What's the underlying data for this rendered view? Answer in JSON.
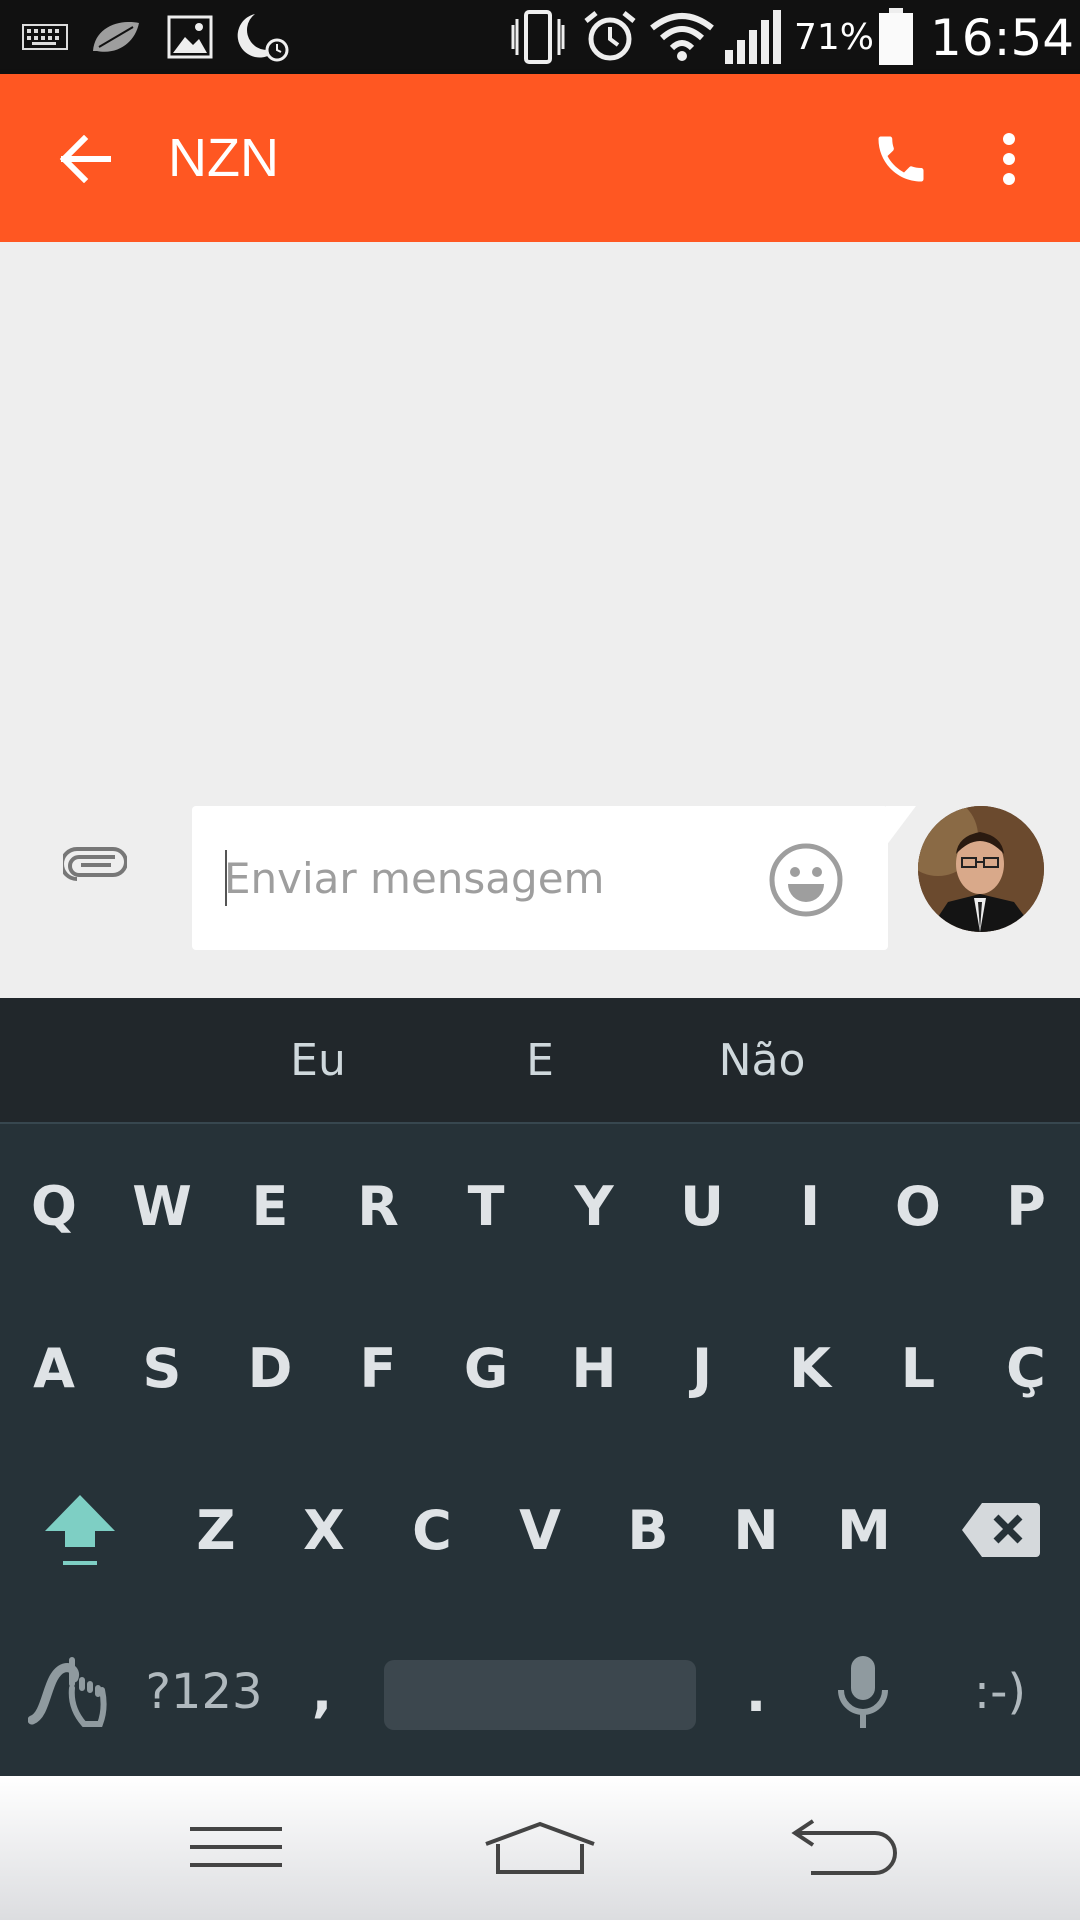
{
  "status_bar": {
    "battery_percent": "71%",
    "time": "16:54",
    "icons": [
      "keyboard-icon",
      "leaf-icon",
      "image-icon",
      "moon-clock-icon",
      "vibrate-icon",
      "alarm-icon",
      "wifi-icon",
      "signal-icon",
      "battery-icon"
    ]
  },
  "toolbar": {
    "title": "NZN",
    "back_icon": "arrow-back-icon",
    "call_icon": "phone-icon",
    "menu_icon": "more-vert-icon",
    "color": "#ff5722"
  },
  "compose": {
    "placeholder": "Enviar mensagem",
    "value": "",
    "attach_icon": "paperclip-icon",
    "emoji_icon": "smiley-icon"
  },
  "keyboard": {
    "suggestions": [
      "Eu",
      "E",
      "Não"
    ],
    "row1": [
      "Q",
      "W",
      "E",
      "R",
      "T",
      "Y",
      "U",
      "I",
      "O",
      "P"
    ],
    "row2": [
      "A",
      "S",
      "D",
      "F",
      "G",
      "H",
      "J",
      "K",
      "L",
      "Ç"
    ],
    "row3": [
      "Z",
      "X",
      "C",
      "V",
      "B",
      "N",
      "M"
    ],
    "symbols_label": "?123",
    "comma": ",",
    "period": ".",
    "emoticon": ":-)",
    "accent_color": "#7ecfc4"
  },
  "nav_bar": {
    "icons": [
      "menu-icon",
      "home-icon",
      "back-icon"
    ]
  }
}
